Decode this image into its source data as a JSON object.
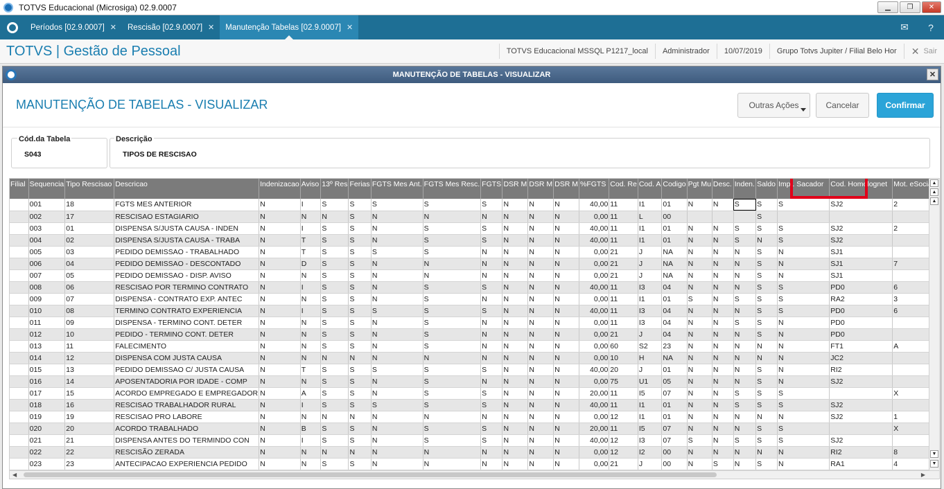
{
  "window": {
    "title": "TOTVS Educacional (Microsiga) 02.9.0007"
  },
  "tabs": [
    {
      "label": "Períodos [02.9.0007]"
    },
    {
      "label": "Rescisão [02.9.0007]"
    },
    {
      "label": "Manutenção Tabelas [02.9.0007]"
    }
  ],
  "header": {
    "brand": "TOTVS | Gestão de Pessoal",
    "environment": "TOTVS Educacional MSSQL P1217_local",
    "user": "Administrador",
    "date": "10/07/2019",
    "company": "Grupo Totvs Jupiter / Filial Belo Hor",
    "exit_label": "Sair"
  },
  "dialog": {
    "title": "MANUTENÇÃO DE TABELAS - VISUALIZAR",
    "page_title": "MANUTENÇÃO DE TABELAS - VISUALIZAR",
    "buttons": {
      "other": "Outras Ações",
      "cancel": "Cancelar",
      "confirm": "Confirmar"
    },
    "fields": {
      "codigo_label": "Cód.da Tabela",
      "codigo_value": "S043",
      "descricao_label": "Descrição",
      "descricao_value": "TIPOS DE RESCISAO"
    }
  },
  "colors": {
    "tabbar": "#1e6f95",
    "brand": "#1a7eb0",
    "confirm": "#2ba4d8",
    "highlight": "#e1001a"
  },
  "grid": {
    "headers": [
      "Filial",
      "Sequencia",
      "Tipo Rescisao",
      "Descricao",
      "Indenizacao",
      "Aviso",
      "13º Res",
      "Ferias",
      "FGTS Mes Ant.",
      "FGTS Mes Resc.",
      "FGTS",
      "DSR M",
      "DSR M",
      "DSR M",
      "%FGTS",
      "Cod. Re",
      "Cod. A",
      "Codigo",
      "Pgt Mu",
      "Desc.",
      "Inden.",
      "Saldo",
      "Impr. Sacador",
      "Cod. Homolognet",
      "Mot. eSocial"
    ],
    "rows": [
      [
        "",
        "001",
        "18",
        "FGTS MES ANTERIOR",
        "N",
        "I",
        "S",
        "S",
        "S",
        "S",
        "S",
        "N",
        "N",
        "N",
        "40,00",
        "11",
        "I1",
        "01",
        "N",
        "N",
        "S",
        "S",
        "S",
        "SJ2",
        "2"
      ],
      [
        "",
        "002",
        "17",
        "RESCISAO ESTAGIARIO",
        "N",
        "N",
        "N",
        "S",
        "N",
        "N",
        "N",
        "N",
        "N",
        "N",
        "0,00",
        "11",
        "L",
        "00",
        "",
        "",
        "",
        "S",
        "",
        "",
        ""
      ],
      [
        "",
        "003",
        "01",
        "DISPENSA S/JUSTA CAUSA - INDEN",
        "N",
        "I",
        "S",
        "S",
        "N",
        "S",
        "S",
        "N",
        "N",
        "N",
        "40,00",
        "11",
        "I1",
        "01",
        "N",
        "N",
        "S",
        "S",
        "S",
        "SJ2",
        "2"
      ],
      [
        "",
        "004",
        "02",
        "DISPENSA S/JUSTA CAUSA - TRABA",
        "N",
        "T",
        "S",
        "S",
        "N",
        "S",
        "S",
        "N",
        "N",
        "N",
        "40,00",
        "11",
        "I1",
        "01",
        "N",
        "N",
        "S",
        "N",
        "S",
        "SJ2",
        ""
      ],
      [
        "",
        "005",
        "03",
        "PEDIDO DEMISSAO - TRABALHADO",
        "N",
        "T",
        "S",
        "S",
        "S",
        "S",
        "N",
        "N",
        "N",
        "N",
        "0,00",
        "21",
        "J",
        "NA",
        "N",
        "N",
        "N",
        "S",
        "N",
        "SJ1",
        ""
      ],
      [
        "",
        "006",
        "04",
        "PEDIDO DEMISSAO - DESCONTADO",
        "N",
        "D",
        "S",
        "S",
        "N",
        "N",
        "N",
        "N",
        "N",
        "N",
        "0,00",
        "21",
        "J",
        "NA",
        "N",
        "N",
        "N",
        "S",
        "N",
        "SJ1",
        "7"
      ],
      [
        "",
        "007",
        "05",
        "PEDIDO DEMISSAO - DISP. AVISO",
        "N",
        "N",
        "S",
        "S",
        "N",
        "N",
        "N",
        "N",
        "N",
        "N",
        "0,00",
        "21",
        "J",
        "NA",
        "N",
        "N",
        "N",
        "S",
        "N",
        "SJ1",
        ""
      ],
      [
        "",
        "008",
        "06",
        "RESCISAO POR TERMINO CONTRATO",
        "N",
        "I",
        "S",
        "S",
        "N",
        "S",
        "S",
        "N",
        "N",
        "N",
        "40,00",
        "11",
        "I3",
        "04",
        "N",
        "N",
        "N",
        "S",
        "S",
        "PD0",
        "6"
      ],
      [
        "",
        "009",
        "07",
        "DISPENSA - CONTRATO EXP. ANTEC",
        "N",
        "N",
        "S",
        "S",
        "N",
        "S",
        "N",
        "N",
        "N",
        "N",
        "0,00",
        "11",
        "I1",
        "01",
        "S",
        "N",
        "S",
        "S",
        "S",
        "RA2",
        "3"
      ],
      [
        "",
        "010",
        "08",
        "TERMINO CONTRATO EXPERIENCIA",
        "N",
        "I",
        "S",
        "S",
        "S",
        "S",
        "S",
        "N",
        "N",
        "N",
        "40,00",
        "11",
        "I3",
        "04",
        "N",
        "N",
        "N",
        "S",
        "S",
        "PD0",
        "6"
      ],
      [
        "",
        "011",
        "09",
        "DISPENSA - TERMINO CONT. DETER",
        "N",
        "N",
        "S",
        "S",
        "N",
        "S",
        "N",
        "N",
        "N",
        "N",
        "0,00",
        "11",
        "I3",
        "04",
        "N",
        "N",
        "S",
        "S",
        "N",
        "PD0",
        ""
      ],
      [
        "",
        "012",
        "10",
        "PEDIDO - TERMINO CONT. DETER",
        "N",
        "N",
        "S",
        "S",
        "N",
        "S",
        "N",
        "N",
        "N",
        "N",
        "0,00",
        "21",
        "J",
        "04",
        "N",
        "N",
        "N",
        "S",
        "N",
        "PD0",
        ""
      ],
      [
        "",
        "013",
        "11",
        "FALECIMENTO",
        "N",
        "N",
        "S",
        "S",
        "N",
        "S",
        "N",
        "N",
        "N",
        "N",
        "0,00",
        "60",
        "S2",
        "23",
        "N",
        "N",
        "N",
        "N",
        "N",
        "FT1",
        "A"
      ],
      [
        "",
        "014",
        "12",
        "DISPENSA COM JUSTA CAUSA",
        "N",
        "N",
        "N",
        "N",
        "N",
        "N",
        "N",
        "N",
        "N",
        "N",
        "0,00",
        "10",
        "H",
        "NA",
        "N",
        "N",
        "N",
        "N",
        "N",
        "JC2",
        ""
      ],
      [
        "",
        "015",
        "13",
        "PEDIDO DEMISSAO C/ JUSTA CAUSA",
        "N",
        "T",
        "S",
        "S",
        "S",
        "S",
        "S",
        "N",
        "N",
        "N",
        "40,00",
        "20",
        "J",
        "01",
        "N",
        "N",
        "N",
        "S",
        "N",
        "RI2",
        ""
      ],
      [
        "",
        "016",
        "14",
        "APOSENTADORIA POR IDADE - COMP",
        "N",
        "N",
        "S",
        "S",
        "N",
        "S",
        "N",
        "N",
        "N",
        "N",
        "0,00",
        "75",
        "U1",
        "05",
        "N",
        "N",
        "N",
        "S",
        "N",
        "SJ2",
        ""
      ],
      [
        "",
        "017",
        "15",
        "ACORDO EMPREGADO E EMPREGADOR",
        "N",
        "A",
        "S",
        "S",
        "N",
        "S",
        "S",
        "N",
        "N",
        "N",
        "20,00",
        "11",
        "I5",
        "07",
        "N",
        "N",
        "S",
        "S",
        "S",
        "",
        "X"
      ],
      [
        "",
        "018",
        "16",
        "RESCISAO TRABALHADOR RURAL",
        "N",
        "I",
        "S",
        "S",
        "S",
        "S",
        "S",
        "N",
        "N",
        "N",
        "40,00",
        "11",
        "I1",
        "01",
        "N",
        "N",
        "S",
        "S",
        "S",
        "SJ2",
        ""
      ],
      [
        "",
        "019",
        "19",
        "RESCISAO PRO LABORE",
        "N",
        "N",
        "N",
        "N",
        "N",
        "N",
        "N",
        "N",
        "N",
        "N",
        "0,00",
        "12",
        "I1",
        "01",
        "N",
        "N",
        "N",
        "N",
        "N",
        "SJ2",
        "1"
      ],
      [
        "",
        "020",
        "20",
        "ACORDO TRABALHADO",
        "N",
        "B",
        "S",
        "S",
        "N",
        "S",
        "S",
        "N",
        "N",
        "N",
        "20,00",
        "11",
        "I5",
        "07",
        "N",
        "N",
        "N",
        "S",
        "S",
        "",
        "X"
      ],
      [
        "",
        "021",
        "21",
        "DISPENSA ANTES DO TERMINDO CON",
        "N",
        "I",
        "S",
        "S",
        "N",
        "S",
        "S",
        "N",
        "N",
        "N",
        "40,00",
        "12",
        "I3",
        "07",
        "S",
        "N",
        "S",
        "S",
        "S",
        "SJ2",
        ""
      ],
      [
        "",
        "022",
        "22",
        "RESCISÃO ZERADA",
        "N",
        "N",
        "N",
        "N",
        "N",
        "N",
        "N",
        "N",
        "N",
        "N",
        "0,00",
        "12",
        "I2",
        "00",
        "N",
        "N",
        "N",
        "N",
        "N",
        "RI2",
        "8"
      ],
      [
        "",
        "023",
        "23",
        "ANTECIPACAO EXPERIENCIA PEDIDO",
        "N",
        "N",
        "S",
        "S",
        "N",
        "N",
        "N",
        "N",
        "N",
        "N",
        "0,00",
        "21",
        "J",
        "00",
        "N",
        "S",
        "N",
        "S",
        "N",
        "RA1",
        "4"
      ]
    ]
  }
}
